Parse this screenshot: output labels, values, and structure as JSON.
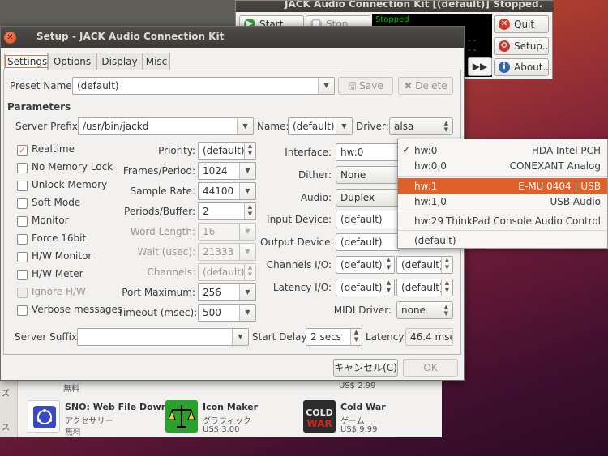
{
  "background": {
    "software_center": {
      "tab_label": "…",
      "left_labels": [
        "ズ",
        "ス"
      ],
      "prev_prices": [
        "無料",
        "US$ 2.99"
      ],
      "apps": [
        {
          "name": "SNO: Web File Downl…",
          "category": "アクセサリー",
          "price": "無料"
        },
        {
          "name": "Icon Maker",
          "category": "グラフィック",
          "price": "US$ 3.00"
        },
        {
          "name": "Cold War",
          "category": "ゲーム",
          "price": "US$ 9.99",
          "logo_text": "COLD WAR"
        }
      ]
    }
  },
  "jack_main": {
    "title": "JACK Audio Connection Kit [(default)] Stopped.",
    "start_label": "Start",
    "stop_label": "Stop",
    "status_text": "Stopped",
    "quit_label": "Quit",
    "setup_label": "Setup...",
    "about_label": "About...",
    "ffw_icon": "fast-forward-icon"
  },
  "dialog": {
    "title": "Setup - JACK Audio Connection Kit",
    "tabs": [
      "Settings",
      "Options",
      "Display",
      "Misc"
    ],
    "active_tab": "Settings",
    "preset_label": "Preset Name:",
    "preset_value": "(default)",
    "save_label": "Save",
    "delete_label": "Delete",
    "parameters_label": "Parameters",
    "server_prefix_label": "Server Prefix:",
    "server_prefix_value": "/usr/bin/jackd",
    "name_label": "Name:",
    "name_value": "(default)",
    "driver_label": "Driver:",
    "driver_value": "alsa",
    "checkboxes": [
      {
        "label": "Realtime",
        "checked": true,
        "enabled": true
      },
      {
        "label": "No Memory Lock",
        "checked": false,
        "enabled": true
      },
      {
        "label": "Unlock Memory",
        "checked": false,
        "enabled": true
      },
      {
        "label": "Soft Mode",
        "checked": false,
        "enabled": true
      },
      {
        "label": "Monitor",
        "checked": false,
        "enabled": true
      },
      {
        "label": "Force 16bit",
        "checked": false,
        "enabled": true
      },
      {
        "label": "H/W Monitor",
        "checked": false,
        "enabled": true
      },
      {
        "label": "H/W Meter",
        "checked": false,
        "enabled": true
      },
      {
        "label": "Ignore H/W",
        "checked": false,
        "enabled": false
      },
      {
        "label": "Verbose messages",
        "checked": false,
        "enabled": true
      }
    ],
    "params": [
      {
        "label": "Priority:",
        "value": "(default)",
        "enabled": true,
        "kind": "spin"
      },
      {
        "label": "Frames/Period:",
        "value": "1024",
        "enabled": true,
        "kind": "combo"
      },
      {
        "label": "Sample Rate:",
        "value": "44100",
        "enabled": true,
        "kind": "combo"
      },
      {
        "label": "Periods/Buffer:",
        "value": "2",
        "enabled": true,
        "kind": "spin"
      },
      {
        "label": "Word Length:",
        "value": "16",
        "enabled": false,
        "kind": "combo"
      },
      {
        "label": "Wait (usec):",
        "value": "21333",
        "enabled": false,
        "kind": "combo"
      },
      {
        "label": "Channels:",
        "value": "(default)",
        "enabled": false,
        "kind": "spin"
      },
      {
        "label": "Port Maximum:",
        "value": "256",
        "enabled": true,
        "kind": "combo"
      },
      {
        "label": "Timeout (msec):",
        "value": "500",
        "enabled": true,
        "kind": "combo"
      }
    ],
    "interface_label": "Interface:",
    "interface_value": "hw:0",
    "dither_label": "Dither:",
    "dither_value": "None",
    "audio_label": "Audio:",
    "audio_value": "Duplex",
    "input_device_label": "Input Device:",
    "input_device_value": "(default)",
    "output_device_label": "Output Device:",
    "output_device_value": "(default)",
    "channels_io_label": "Channels I/O:",
    "channels_in_value": "(default)",
    "channels_out_value": "(default)",
    "latency_io_label": "Latency I/O:",
    "latency_in_value": "(default)",
    "latency_out_value": "(default)",
    "midi_driver_label": "MIDI Driver:",
    "midi_driver_value": "none",
    "server_suffix_label": "Server Suffix:",
    "server_suffix_value": "",
    "start_delay_label": "Start Delay:",
    "start_delay_value": "2 secs",
    "latency_label": "Latency:",
    "latency_value": "46.4 msec",
    "cancel_label": "キャンセル(C)",
    "ok_label": "OK"
  },
  "interface_menu": {
    "items": [
      {
        "key": "hw:0",
        "desc": "HDA Intel PCH",
        "checked": true,
        "highlighted": false
      },
      {
        "key": "hw:0,0",
        "desc": "CONEXANT Analog",
        "checked": false,
        "highlighted": false
      },
      {
        "key": "hw:1",
        "desc": "E-MU 0404 | USB",
        "checked": false,
        "highlighted": true
      },
      {
        "key": "hw:1,0",
        "desc": "USB Audio",
        "checked": false,
        "highlighted": false
      },
      {
        "key": "hw:29",
        "desc": "ThinkPad Console Audio Control",
        "checked": false,
        "highlighted": false
      },
      {
        "key": "(default)",
        "desc": "",
        "checked": false,
        "highlighted": false
      }
    ]
  },
  "colors": {
    "accent": "#e0602a",
    "title_bar": "#3c3b37",
    "window_bg": "#f2f1f0"
  }
}
